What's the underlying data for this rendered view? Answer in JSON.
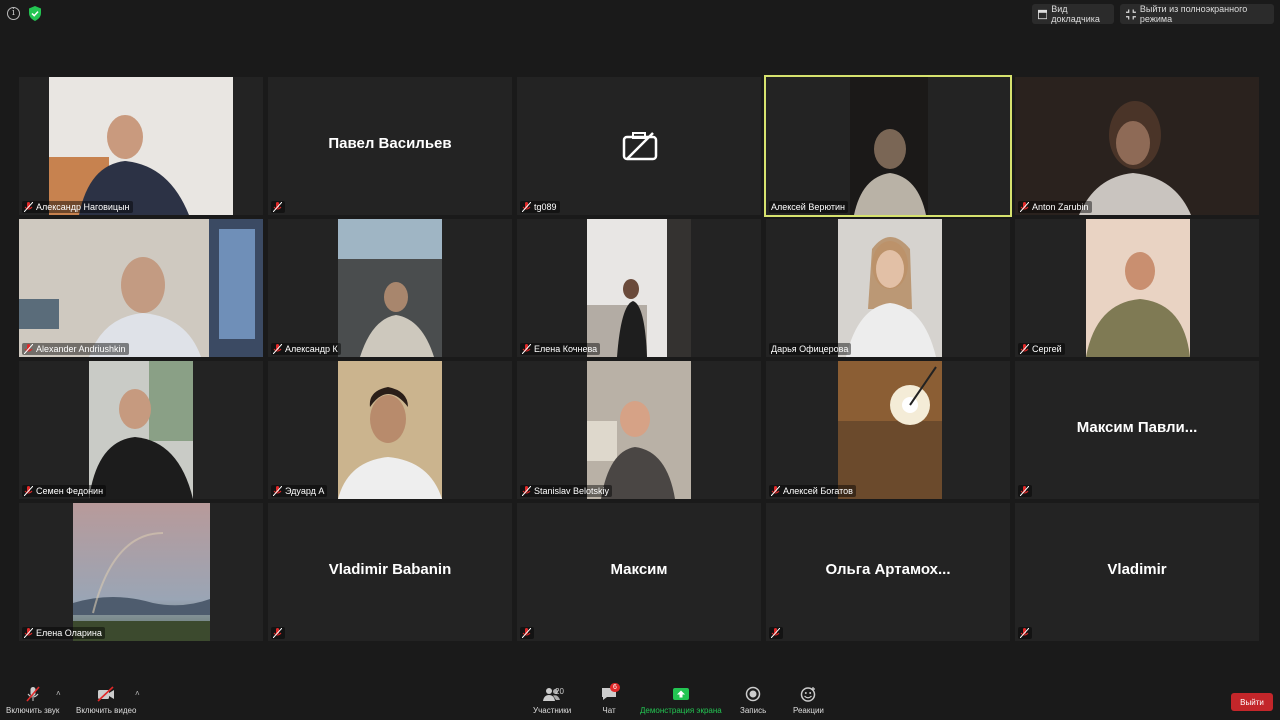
{
  "topbar": {
    "speaker_view": "Вид докладчика",
    "exit_fullscreen": "Выйти из полноэкранного режима"
  },
  "tiles": [
    {
      "name": "Александр Наговицын",
      "video": true
    },
    {
      "name": "Павел Васильев",
      "video": false
    },
    {
      "name": "tg089",
      "video": false
    },
    {
      "name": "Алексей Верютин",
      "video": true,
      "active": true
    },
    {
      "name": "Anton Zarubin",
      "video": true
    },
    {
      "name": "Alexander Andriushkin",
      "video": true
    },
    {
      "name": "Александр К",
      "video": true
    },
    {
      "name": "Елена Кочнева",
      "video": true
    },
    {
      "name": "Дарья Офицерова",
      "video": true
    },
    {
      "name": "Сергей",
      "video": true
    },
    {
      "name": "Семен Федонин",
      "video": true
    },
    {
      "name": "Эдуард А",
      "video": true
    },
    {
      "name": "Stanislav Belotskiy",
      "video": true
    },
    {
      "name": "Алексей Богатов",
      "video": true
    },
    {
      "name": "Максим Павли...",
      "video": false
    },
    {
      "name": "Елена Оларина",
      "video": true
    },
    {
      "name": "Vladimir Babanin",
      "video": false
    },
    {
      "name": "Максим",
      "video": false
    },
    {
      "name": "Ольга Артамох...",
      "video": false
    },
    {
      "name": "Vladimir",
      "video": false
    }
  ],
  "toolbar": {
    "mute": "Включить звук",
    "video": "Включить видео",
    "participants": "Участники",
    "participants_count": "20",
    "chat": "Чат",
    "chat_badge": "6",
    "share": "Демонстрация экрана",
    "record": "Запись",
    "reactions": "Реакции",
    "leave": "Выйти"
  },
  "colors": {
    "background": "#1a1a1a",
    "tile": "#232323",
    "active_border": "#d6e26e",
    "share_green": "#23c552",
    "leave_red": "#c3262a",
    "mute_red": "#e02828"
  }
}
